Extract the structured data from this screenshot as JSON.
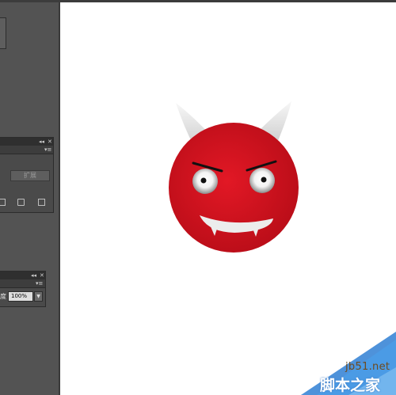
{
  "panel_1": {
    "expand_button_label": "扩展"
  },
  "panel_2": {
    "opacity_label": "度",
    "opacity_value": "100%"
  },
  "watermark": {
    "domain": "jb51.net",
    "title": "脚本之家"
  },
  "colors": {
    "workspace_bg": "#535353",
    "face_red": "#d2121f",
    "horn": "#e6e6e6",
    "watermark_blue": "#3b86d6"
  },
  "icons": [
    "collapse-icon",
    "close-icon",
    "panel-menu-icon",
    "pathfinder-icons",
    "dropdown-arrow-icon",
    "devil-face-illustration"
  ]
}
